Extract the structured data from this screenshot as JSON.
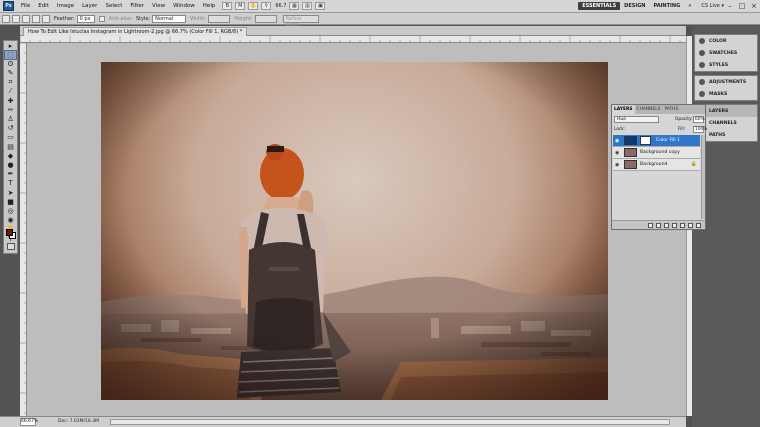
{
  "app": {
    "logo": "Ps",
    "menu": [
      "File",
      "Edit",
      "Image",
      "Layer",
      "Select",
      "Filter",
      "View",
      "Window",
      "Help"
    ],
    "zoom_dropdown": "66.7",
    "workspaces": [
      "ESSENTIALS",
      "DESIGN",
      "PAINTING"
    ],
    "more": "»",
    "cs_live": "CS Live ▾",
    "window_controls": [
      "–",
      "□",
      "×"
    ]
  },
  "options_bar": {
    "feather_label": "Feather:",
    "feather_value": "0 px",
    "antialias_label": "Anti-alias",
    "style_label": "Style:",
    "style_value": "Normal",
    "width_label": "Width:",
    "height_label": "Height:",
    "refine_edge": "Refine Edge..."
  },
  "document": {
    "title": "How To Edit Like Istuclas Instagram in Lightroom-2.jpg @ 66.7% (Color Fill 1, RGB/8) *",
    "zoom": "66.67%",
    "doc_info": "Doc: 7.03M/16.3M"
  },
  "toolbox": {
    "tools": [
      {
        "name": "move-tool-icon",
        "glyph": "▸"
      },
      {
        "name": "marquee-tool-icon",
        "glyph": "⬚"
      },
      {
        "name": "lasso-tool-icon",
        "glyph": "ʘ"
      },
      {
        "name": "quick-select-tool-icon",
        "glyph": "✎"
      },
      {
        "name": "crop-tool-icon",
        "glyph": "⌗"
      },
      {
        "name": "eyedropper-tool-icon",
        "glyph": "⁄"
      },
      {
        "name": "healing-brush-tool-icon",
        "glyph": "✚"
      },
      {
        "name": "brush-tool-icon",
        "glyph": "✏"
      },
      {
        "name": "clone-stamp-tool-icon",
        "glyph": "♙"
      },
      {
        "name": "history-brush-tool-icon",
        "glyph": "↺"
      },
      {
        "name": "eraser-tool-icon",
        "glyph": "▭"
      },
      {
        "name": "gradient-tool-icon",
        "glyph": "▤"
      },
      {
        "name": "blur-tool-icon",
        "glyph": "◆"
      },
      {
        "name": "dodge-tool-icon",
        "glyph": "●"
      },
      {
        "name": "pen-tool-icon",
        "glyph": "✒"
      },
      {
        "name": "type-tool-icon",
        "glyph": "T"
      },
      {
        "name": "path-select-tool-icon",
        "glyph": "➤"
      },
      {
        "name": "shape-tool-icon",
        "glyph": "■"
      },
      {
        "name": "3d-rotate-tool-icon",
        "glyph": "◎"
      },
      {
        "name": "3d-orbit-tool-icon",
        "glyph": "◉"
      },
      {
        "name": "hand-tool-icon",
        "glyph": "✋"
      },
      {
        "name": "zoom-tool-icon",
        "glyph": "⚲"
      }
    ],
    "foreground_color": "#6b1a12",
    "background_color": "#ffffff"
  },
  "dock": {
    "group1": [
      {
        "label": "COLOR",
        "icon": "color-icon"
      },
      {
        "label": "SWATCHES",
        "icon": "swatches-icon"
      },
      {
        "label": "STYLES",
        "icon": "styles-icon"
      }
    ],
    "group2": [
      {
        "label": "ADJUSTMENTS",
        "icon": "adjustments-icon"
      },
      {
        "label": "MASKS",
        "icon": "masks-icon"
      }
    ],
    "group3": [
      {
        "label": "LAYERS",
        "icon": "layers-icon"
      },
      {
        "label": "CHANNELS",
        "icon": "channels-icon"
      },
      {
        "label": "PATHS",
        "icon": "paths-icon"
      }
    ]
  },
  "layers_panel": {
    "tabs": [
      "LAYERS",
      "CHANNELS",
      "PATHS"
    ],
    "blend_mode": "Hue",
    "opacity_label": "Opacity:",
    "opacity": "60%",
    "lock_label": "Lock:",
    "fill_label": "Fill:",
    "fill": "100%",
    "layers": [
      {
        "name": "Color Fill 1",
        "selected": true,
        "thumb_color": "#0a3a78",
        "mask": true,
        "lock": ""
      },
      {
        "name": "Background copy",
        "selected": false,
        "thumb_color": "#8a6a66",
        "mask": false,
        "lock": ""
      },
      {
        "name": "Background",
        "selected": false,
        "thumb_color": "#8a6a66",
        "mask": false,
        "lock": "🔒"
      }
    ]
  }
}
